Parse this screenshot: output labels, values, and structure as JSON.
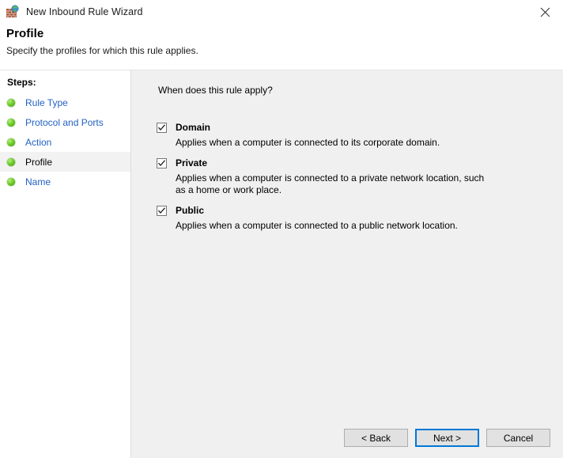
{
  "window": {
    "title": "New Inbound Rule Wizard",
    "icon": "firewall-globe-icon",
    "close_label": "✕"
  },
  "header": {
    "heading": "Profile",
    "subtitle": "Specify the profiles for which this rule applies."
  },
  "sidebar": {
    "title": "Steps:",
    "items": [
      {
        "label": "Rule Type",
        "current": false
      },
      {
        "label": "Protocol and Ports",
        "current": false
      },
      {
        "label": "Action",
        "current": false
      },
      {
        "label": "Profile",
        "current": true
      },
      {
        "label": "Name",
        "current": false
      }
    ]
  },
  "main": {
    "question": "When does this rule apply?",
    "options": [
      {
        "label": "Domain",
        "checked": true,
        "description": "Applies when a computer is connected to its corporate domain."
      },
      {
        "label": "Private",
        "checked": true,
        "description": "Applies when a computer is connected to a private network location, such as a home or work place."
      },
      {
        "label": "Public",
        "checked": true,
        "description": "Applies when a computer is connected to a public network location."
      }
    ]
  },
  "footer": {
    "back_label": "< Back",
    "next_label": "Next >",
    "cancel_label": "Cancel"
  },
  "colors": {
    "link": "#2161c4",
    "accent": "#0078d7",
    "content_bg": "#f0f0f0",
    "button_bg": "#e1e1e1",
    "bullet_green": "#6fcf2a"
  }
}
